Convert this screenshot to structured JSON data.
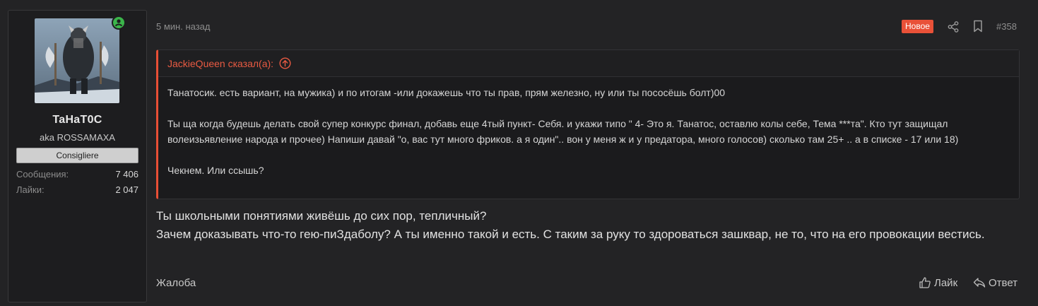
{
  "author": {
    "avatar_alt": "avatar",
    "username": "TaHaT0C",
    "aka": "aka ROSSAMAXA",
    "role": "Consigliere",
    "online": true,
    "stats": [
      {
        "label": "Сообщения:",
        "value": "7 406"
      },
      {
        "label": "Лайки:",
        "value": "2 047"
      }
    ]
  },
  "post": {
    "time": "5 мин. назад",
    "new_badge": "Новое",
    "number": "#358",
    "quote": {
      "author_line": "JackieQueen сказал(а):",
      "paragraphs": [
        "Танатосик. есть вариант, на мужика) и по итогам -или докажешь что ты прав, прям железно, ну или ты пососёшь болт)00",
        "Ты ща когда будешь делать свой супер конкурс финал, добавь еще 4тый пункт- Себя. и укажи типо \" 4- Это я. Танатос, оставлю колы себе, Тема ***та\". Кто тут защищал волеизьявление народа и прочее) Напиши давай \"о, вас тут много фриков. а я один\".. вон у меня ж и у предатора, много голосов) сколько там 25+ .. а в списке - 17 или 18)",
        "Чекнем. Или ссышь?"
      ]
    },
    "message_lines": [
      "Ты школьными понятиями живёшь до сих пор, тепличный?",
      "Зачем доказывать что-то гею-пиЗдаболу? А ты именно такой и есть. С таким за руку то здороваться зашквар, не то, что на его провокации вестись."
    ],
    "actions": {
      "report": "Жалоба",
      "like": "Лайк",
      "reply": "Ответ"
    }
  },
  "colors": {
    "accent": "#e95138",
    "online": "#3bb54a",
    "background": "#232325"
  }
}
